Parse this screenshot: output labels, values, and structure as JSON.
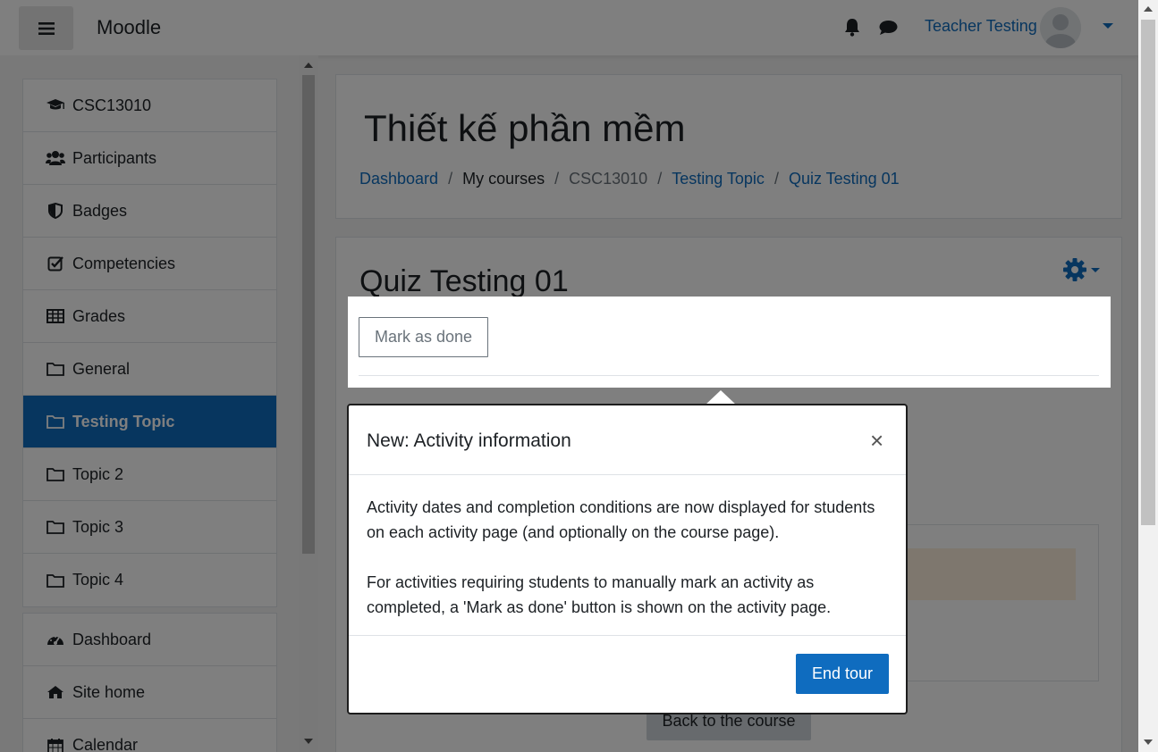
{
  "navbar": {
    "brand": "Moodle",
    "user_name": "Teacher Testing"
  },
  "sidebar": {
    "course_items": [
      {
        "label": "CSC13010",
        "icon": "graduation-cap-icon"
      },
      {
        "label": "Participants",
        "icon": "users-icon"
      },
      {
        "label": "Badges",
        "icon": "shield-icon"
      },
      {
        "label": "Competencies",
        "icon": "check-square-icon"
      },
      {
        "label": "Grades",
        "icon": "table-icon"
      },
      {
        "label": "General",
        "icon": "folder-icon"
      },
      {
        "label": "Testing Topic",
        "icon": "folder-icon"
      },
      {
        "label": "Topic 2",
        "icon": "folder-icon"
      },
      {
        "label": "Topic 3",
        "icon": "folder-icon"
      },
      {
        "label": "Topic 4",
        "icon": "folder-icon"
      }
    ],
    "active_item": "Testing Topic",
    "site_items": [
      {
        "label": "Dashboard",
        "icon": "tachometer-icon"
      },
      {
        "label": "Site home",
        "icon": "home-icon"
      },
      {
        "label": "Calendar",
        "icon": "calendar-icon"
      }
    ]
  },
  "header": {
    "title": "Thiết kế phần mềm",
    "breadcrumb": [
      "Dashboard",
      "My courses",
      "CSC13010",
      "Testing Topic",
      "Quiz Testing 01"
    ]
  },
  "activity": {
    "title": "Quiz Testing 01",
    "mark_done_label": "Mark as done",
    "back_label": "Back to the course"
  },
  "tour": {
    "title": "New: Activity information",
    "close": "×",
    "paragraph1": "Activity dates and completion conditions are now displayed for students on each activity page (and optionally on the course page).",
    "paragraph2": "For activities requiring students to manually mark an activity as completed, a 'Mark as done' button is shown on the activity page.",
    "end_label": "End tour"
  },
  "colors": {
    "primary": "#0f6cbf",
    "backdrop": "rgba(0,0,0,0.5)",
    "alert": "#fcefdc"
  }
}
